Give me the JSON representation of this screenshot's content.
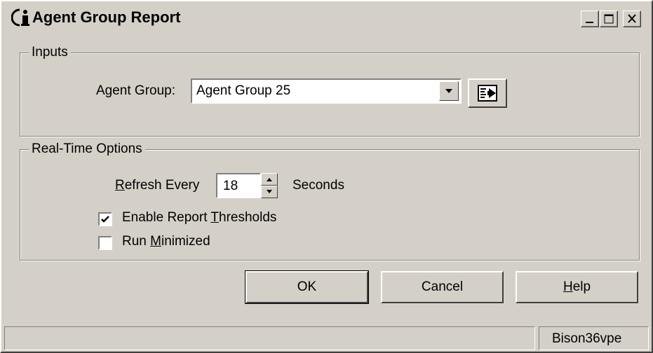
{
  "window": {
    "title": "Agent Group Report",
    "icon": "info-person-icon"
  },
  "title_buttons": [
    "minimize",
    "maximize",
    "close"
  ],
  "inputs": {
    "legend": "Inputs",
    "agent_group_label": "Agent Group:",
    "agent_group_value": "Agent Group 25",
    "browse_icon": "browse-arrow-icon"
  },
  "realtime": {
    "legend": "Real-Time Options",
    "refresh_prefix": "",
    "refresh_mnemonic": "R",
    "refresh_rest": "efresh Every",
    "refresh_value": "18",
    "seconds_label": "Seconds",
    "thresholds": {
      "label_pre": "Enable Report ",
      "mnemonic": "T",
      "label_post": "hresholds",
      "checked": true
    },
    "minimized": {
      "label_pre": "Run ",
      "mnemonic": "M",
      "label_post": "inimized",
      "checked": false
    }
  },
  "buttons": {
    "ok": "OK",
    "cancel": "Cancel",
    "help_mnemonic": "H",
    "help_rest": "elp"
  },
  "status": {
    "main": "",
    "user": "Bison36vpe"
  }
}
